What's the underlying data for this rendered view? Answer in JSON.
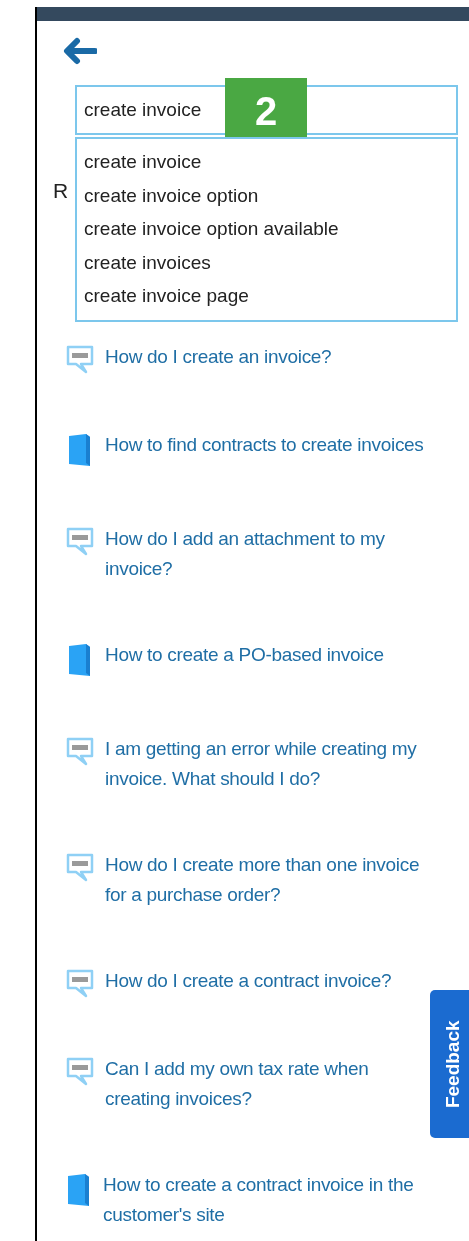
{
  "search": {
    "value": "create invoice"
  },
  "suggestions": [
    "create invoice",
    "create invoice option",
    "create invoice option available",
    "create invoices",
    "create invoice page"
  ],
  "step_badge": "2",
  "heading": "R",
  "results": [
    {
      "kind": "faq",
      "title": "How do I create an invoice?"
    },
    {
      "kind": "book",
      "title": "How to find contracts to create invoices"
    },
    {
      "kind": "faq",
      "title": "How do I add an attachment to my invoice?"
    },
    {
      "kind": "book",
      "title": "How to create a PO-based invoice"
    },
    {
      "kind": "faq",
      "title": "I am getting an error while creating my invoice. What should I do?"
    },
    {
      "kind": "faq",
      "title": "How do I create more than one invoice for a purchase order?"
    },
    {
      "kind": "faq",
      "title": "How do I create a contract invoice?"
    },
    {
      "kind": "faq",
      "title": "Can I add my own tax rate when creating invoices?"
    },
    {
      "kind": "book",
      "title": "How to create a contract invoice in the customer's site"
    }
  ],
  "feedback_tab": "Feedback"
}
